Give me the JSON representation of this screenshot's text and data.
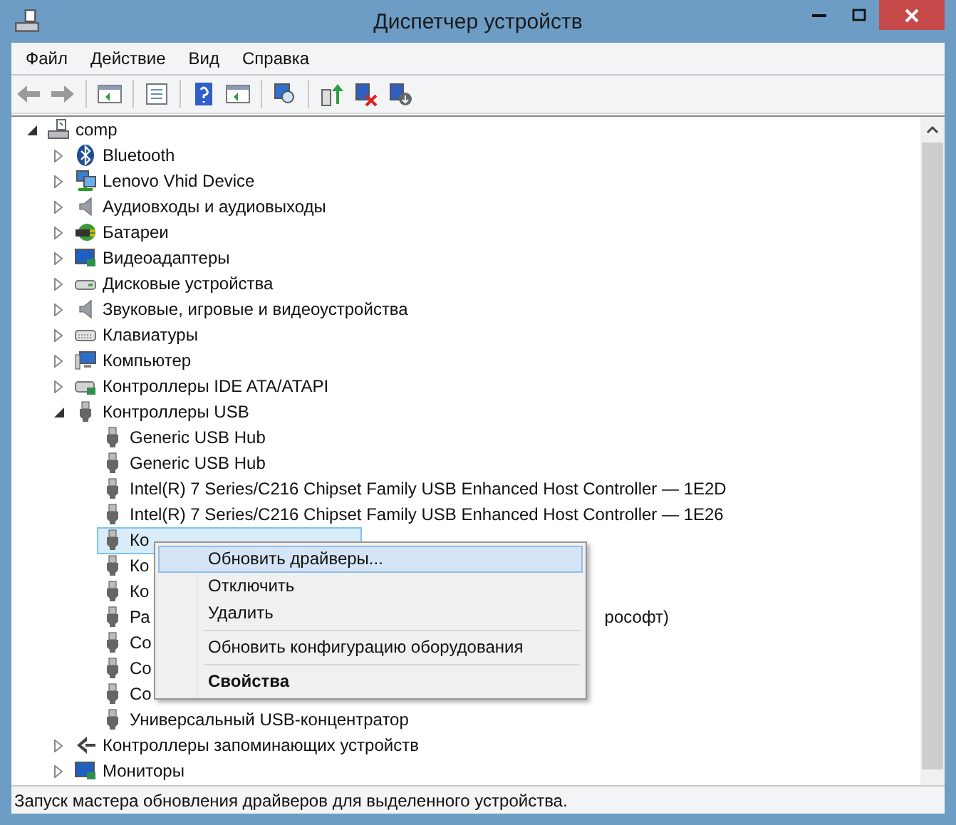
{
  "window": {
    "title": "Диспетчер устройств"
  },
  "menu_bar": [
    "Файл",
    "Действие",
    "Вид",
    "Справка"
  ],
  "tree": [
    {
      "label": "comp",
      "expanded": true,
      "children": [
        {
          "label": "Bluetooth",
          "expanded": false
        },
        {
          "label": "Lenovo Vhid Device",
          "expanded": false
        },
        {
          "label": "Аудиовходы и аудиовыходы",
          "expanded": false
        },
        {
          "label": "Батареи",
          "expanded": false
        },
        {
          "label": "Видеоадаптеры",
          "expanded": false
        },
        {
          "label": "Дисковые устройства",
          "expanded": false
        },
        {
          "label": "Звуковые, игровые и видеоустройства",
          "expanded": false
        },
        {
          "label": "Клавиатуры",
          "expanded": false
        },
        {
          "label": "Компьютер",
          "expanded": false
        },
        {
          "label": "Контроллеры IDE ATA/ATAPI",
          "expanded": false
        },
        {
          "label": "Контроллеры USB",
          "expanded": true,
          "children": [
            {
              "label": "Generic USB Hub",
              "selected": false
            },
            {
              "label": "Generic USB Hub",
              "selected": false
            },
            {
              "label": "Intel(R) 7 Series/C216 Chipset Family USB Enhanced Host Controller — 1E2D",
              "selected": false
            },
            {
              "label": "Intel(R) 7 Series/C216 Chipset Family USB Enhanced Host Controller — 1E26",
              "selected": false
            },
            {
              "label": "Ко",
              "selected": true
            },
            {
              "label": "Ко",
              "selected": false
            },
            {
              "label": "Ко",
              "selected": false
            },
            {
              "label": "Ра",
              "tail": "рософт)",
              "selected": false
            },
            {
              "label": "Со",
              "selected": false
            },
            {
              "label": "Со",
              "selected": false
            },
            {
              "label": "Со",
              "selected": false
            },
            {
              "label": "Универсальный USB-концентратор",
              "selected": false
            }
          ]
        },
        {
          "label": "Контроллеры запоминающих устройств",
          "expanded": false
        },
        {
          "label": "Мониторы",
          "expanded": false
        }
      ]
    }
  ],
  "context_menu": [
    {
      "kind": "item",
      "label": "Обновить драйверы...",
      "selected": true
    },
    {
      "kind": "item",
      "label": "Отключить",
      "selected": false
    },
    {
      "kind": "item",
      "label": "Удалить",
      "selected": false
    },
    {
      "kind": "separator"
    },
    {
      "kind": "item",
      "label": "Обновить конфигурацию оборудования",
      "selected": false
    },
    {
      "kind": "separator"
    },
    {
      "kind": "default",
      "label": "Свойства",
      "selected": false
    }
  ],
  "status_bar": "Запуск мастера обновления драйверов для выделенного устройства."
}
